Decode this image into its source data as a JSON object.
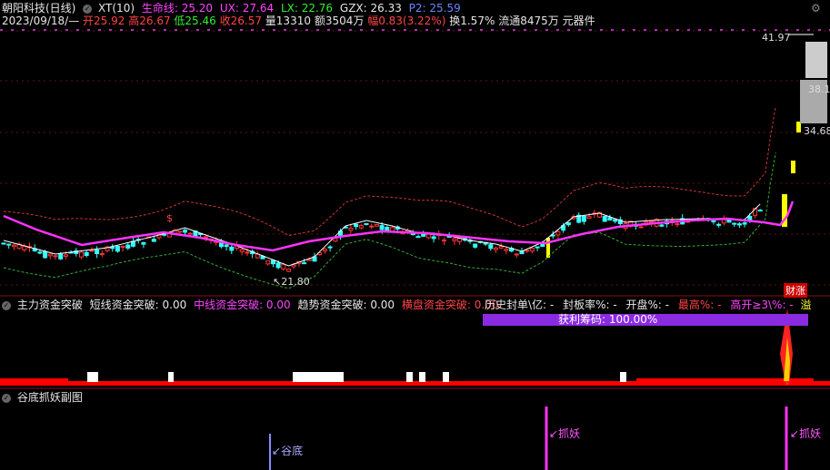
{
  "header": {
    "stock_name": "朝阳科技(日线)",
    "date": "2023/09/18/—",
    "open": "开25.92",
    "high": "高26.67",
    "low": "低25.46",
    "close": "收26.57",
    "volume": "量13310",
    "amount": "额3504万",
    "amplitude": "幅0.83(3.22%)",
    "turnover": "换1.57%",
    "float_cap": "流通8475万",
    "sector": "元器件",
    "indicator_name": "XT(10)",
    "life_line": "生命线: 25.20",
    "ux": "UX: 27.64",
    "lx": "LX: 22.76",
    "gzx": "GZX: 26.33",
    "p2": "P2: 25.59"
  },
  "main_chart": {
    "price_high_label": "41.97",
    "price_mid_label": "38.1",
    "price_label_2": "34.68",
    "price_low_label": "21.80",
    "limit_up_badge": "财涨",
    "dollar_marker": "$"
  },
  "sub1": {
    "title": "主力资金突破",
    "short": "短线资金突破: 0.00",
    "mid": "中线资金突破: 0.00",
    "trend": "趋势资金突破: 0.00",
    "sideways": "横盘资金突破: 0.00",
    "hist_seal": "历史封单\\亿: -",
    "seal_rate": "封板率%: -",
    "open_rate": "开盘%: -",
    "max_rate": "最高%: -",
    "high_open": "高开≥3\\%: -",
    "overflow": "溢",
    "profit_label": "获利筹码: ",
    "profit_value": "100.00%"
  },
  "sub2": {
    "title": "谷底抓妖副图",
    "label_valley": "谷底",
    "label_catch_1": "抓妖",
    "label_catch_2": "抓妖"
  },
  "icons": {
    "settings": "gear-icon",
    "circle_toggle": "circle-toggle-icon"
  },
  "colors": {
    "up": "#ff3333",
    "down": "#33ffff",
    "ma": "#ff33ff",
    "bg": "#000000",
    "grid": "#661111",
    "limit": "#ffff00",
    "bar_fill": "#8a2be2"
  }
}
